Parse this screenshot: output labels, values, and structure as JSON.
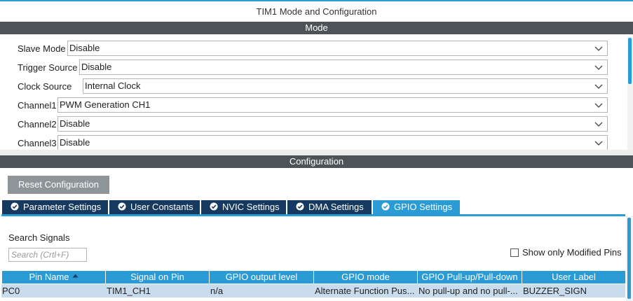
{
  "window": {
    "title": "TIM1 Mode and Configuration"
  },
  "sections": {
    "mode": "Mode",
    "configuration": "Configuration"
  },
  "mode": {
    "slave_mode": {
      "label": "Slave Mode",
      "value": "Disable"
    },
    "trigger_source": {
      "label": "Trigger Source",
      "value": "Disable"
    },
    "clock_source": {
      "label": "Clock Source",
      "value": "Internal Clock"
    },
    "channel1": {
      "label": "Channel1",
      "value": "PWM Generation CH1"
    },
    "channel2": {
      "label": "Channel2",
      "value": "Disable"
    },
    "channel3": {
      "label": "Channel3",
      "value": "Disable"
    }
  },
  "config": {
    "reset_label": "Reset Configuration",
    "tabs": [
      {
        "label": "Parameter Settings",
        "icon": "check-circle-icon"
      },
      {
        "label": "User Constants",
        "icon": "check-circle-icon"
      },
      {
        "label": "NVIC Settings",
        "icon": "check-circle-icon"
      },
      {
        "label": "DMA Settings",
        "icon": "check-circle-icon"
      },
      {
        "label": "GPIO Settings",
        "icon": "check-circle-icon",
        "active": true
      }
    ],
    "search": {
      "label": "Search Signals",
      "placeholder": "Search (Crtl+F)"
    },
    "show_modified": {
      "label": "Show only Modified Pins",
      "checked": false
    },
    "table": {
      "headers": [
        "Pin Name",
        "Signal on Pin",
        "GPIO output level",
        "GPIO mode",
        "GPIO Pull-up/Pull-down",
        "User Label"
      ],
      "rows": [
        [
          "PC0",
          "TIM1_CH1",
          "n/a",
          "Alternate Function Pus...",
          "No pull-up and no pull-...",
          "BUZZER_SIGN"
        ]
      ]
    }
  },
  "colors": {
    "accent": "#2b9bd6",
    "tab_dark": "#163a5f",
    "section_bar": "#4d5458",
    "reset_button": "#8e9599",
    "row_selected": "#c9dcee"
  }
}
